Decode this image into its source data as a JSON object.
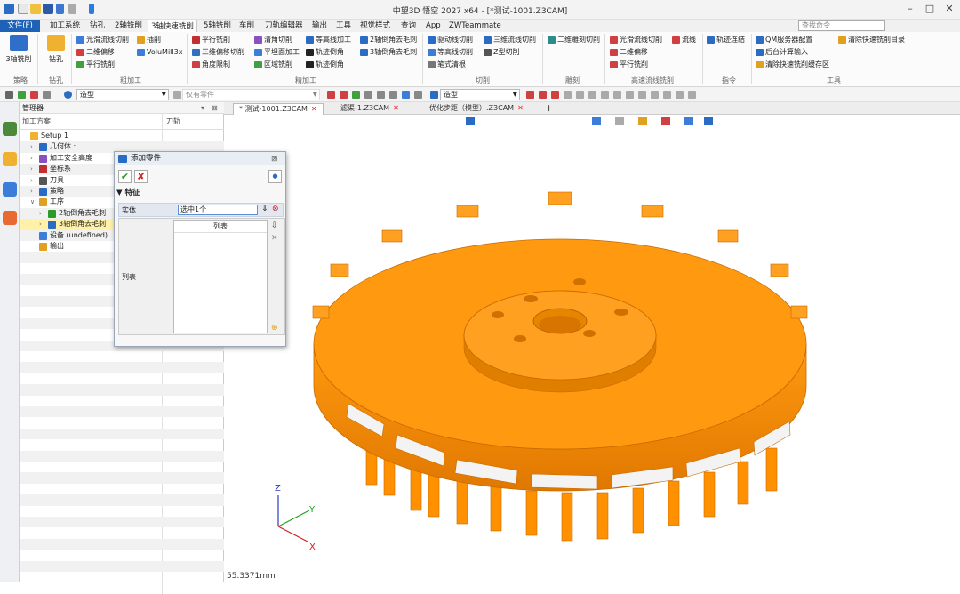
{
  "window": {
    "title": "中望3D 悟空 2027 x64 - [*测试-1001.Z3CAM]"
  },
  "menu": {
    "items": [
      "文件(F)",
      "加工系统",
      "钻孔",
      "2轴铣削",
      "3轴快速铣削",
      "5轴铣削",
      "车削",
      "刀轨编辑器",
      "输出",
      "工具",
      "视觉样式",
      "查询",
      "App",
      "ZWTeammate"
    ],
    "search_placeholder": "查找命令"
  },
  "ribbon": {
    "big_buttons": [
      {
        "label": "3轴铣削"
      },
      {
        "label": "钻孔"
      }
    ],
    "col1": [
      "光滑流线切削",
      "二维偏移",
      "平行铣削"
    ],
    "col2": [
      "插削",
      "VoluMill3x"
    ],
    "col3": [
      "平行铣削",
      "三维偏移切削",
      "角度限制"
    ],
    "col4": [
      "清角切削",
      "平坦面加工",
      "区域铣削"
    ],
    "col5": [
      "等高线加工",
      "轨迹倒角",
      "轨迹倒角"
    ],
    "col6": [
      "2轴倒角去毛刺",
      "3轴倒角去毛刺"
    ],
    "col7": [
      "驱动线切削",
      "等高线切削",
      "笔式清根"
    ],
    "col8": [
      "三维流线切削",
      "Z型切削"
    ],
    "col9": [
      "二维雕刻切削"
    ],
    "col10": [
      "光滑流线切削",
      "二维偏移",
      "平行铣削"
    ],
    "col11": [
      "流线"
    ],
    "col12": [
      "轨迹连结"
    ],
    "col13": [
      "QM服务器配置",
      "后台计算输入",
      "清除快速铣削缓存区"
    ],
    "col14": [
      "清除快速铣削目录"
    ],
    "groups": [
      "策略",
      "钻孔",
      "粗加工",
      "精加工",
      "切削",
      "雕刻",
      "高速流线铣削",
      "指令",
      "工具"
    ]
  },
  "toolbar": {
    "filter_value": "造型",
    "parts_label": "仅有零件"
  },
  "manager": {
    "title": "管理器",
    "col_plan": "加工方案",
    "col_tool": "刀轨",
    "rows": [
      {
        "label": "Setup 1",
        "indent": 0
      },
      {
        "label": "几何体 :",
        "indent": 1
      },
      {
        "label": "加工安全高度",
        "indent": 1
      },
      {
        "label": "坐标系",
        "indent": 1
      },
      {
        "label": "刀具",
        "indent": 1
      },
      {
        "label": "策略",
        "indent": 1
      },
      {
        "label": "工序",
        "indent": 1
      },
      {
        "label": "2轴倒角去毛刺",
        "indent": 2
      },
      {
        "label": "3轴倒角去毛刺",
        "indent": 2
      },
      {
        "label": "设备 (undefined)",
        "indent": 1
      },
      {
        "label": "输出",
        "indent": 1
      }
    ]
  },
  "tabs": [
    {
      "label": "* 测试-1001.Z3CAM",
      "active": true
    },
    {
      "label": "滤渠-1.Z3CAM",
      "active": false
    },
    {
      "label": "优化步距（模型）.Z3CAM",
      "active": false
    }
  ],
  "viewport": {
    "filter_value": "造型",
    "status_text": "55.3371mm"
  },
  "dialog": {
    "title": "添加零件",
    "section": "特征",
    "solid_label": "实体",
    "solid_value": "选中1个",
    "list_label": "列表",
    "list_header": "列表"
  },
  "colors": {
    "part": "#ff9600",
    "accent": "#1e62b8"
  }
}
